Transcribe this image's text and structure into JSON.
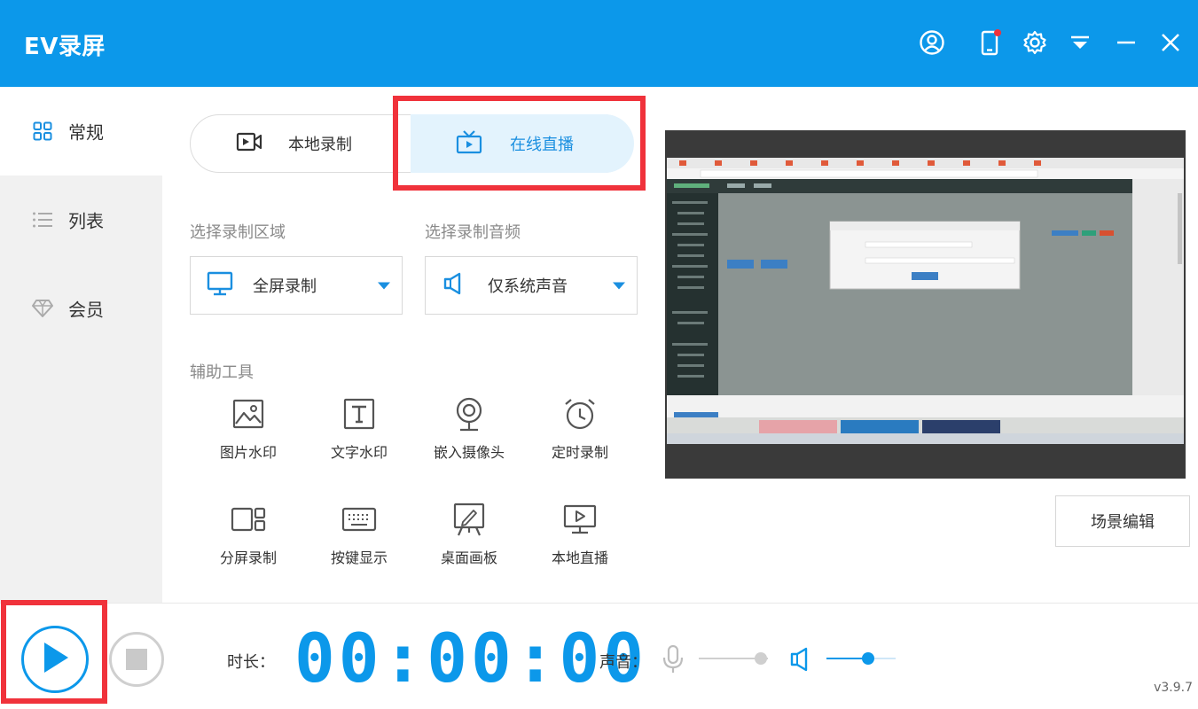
{
  "app": {
    "title": "EV录屏",
    "version": "v3.9.7"
  },
  "titlebar": {
    "icons": [
      "user-icon",
      "phone-icon",
      "settings-icon",
      "dropdown-menu-icon",
      "minimize-icon",
      "close-icon"
    ]
  },
  "sidebar": {
    "items": [
      {
        "label": "常规",
        "icon": "grid-icon",
        "active": true
      },
      {
        "label": "列表",
        "icon": "list-icon",
        "active": false
      },
      {
        "label": "会员",
        "icon": "diamond-icon",
        "active": false
      }
    ]
  },
  "mode_tabs": {
    "local_label": "本地录制",
    "online_label": "在线直播",
    "selected": "在线直播"
  },
  "record_area": {
    "label": "选择录制区域",
    "value": "全屏录制"
  },
  "record_audio": {
    "label": "选择录制音频",
    "value": "仅系统声音"
  },
  "tools": {
    "label": "辅助工具",
    "items": [
      {
        "label": "图片水印",
        "icon": "image-icon"
      },
      {
        "label": "文字水印",
        "icon": "text-icon"
      },
      {
        "label": "嵌入摄像头",
        "icon": "webcam-icon"
      },
      {
        "label": "定时录制",
        "icon": "alarm-clock-icon"
      },
      {
        "label": "分屏录制",
        "icon": "split-screen-icon"
      },
      {
        "label": "按键显示",
        "icon": "keyboard-icon"
      },
      {
        "label": "桌面画板",
        "icon": "whiteboard-icon"
      },
      {
        "label": "本地直播",
        "icon": "monitor-play-icon"
      }
    ]
  },
  "scene_edit_label": "场景编辑",
  "bottom": {
    "duration_label": "时长：",
    "timer": "00:00:00",
    "sound_label": "声音：",
    "mic_level": 0.9,
    "speaker_level": 0.6
  },
  "colors": {
    "accent": "#0c98ea",
    "highlight": "#f0323b",
    "sidebar_bg": "#f1f1f1",
    "tab_selected_bg": "#e3f3fd"
  }
}
